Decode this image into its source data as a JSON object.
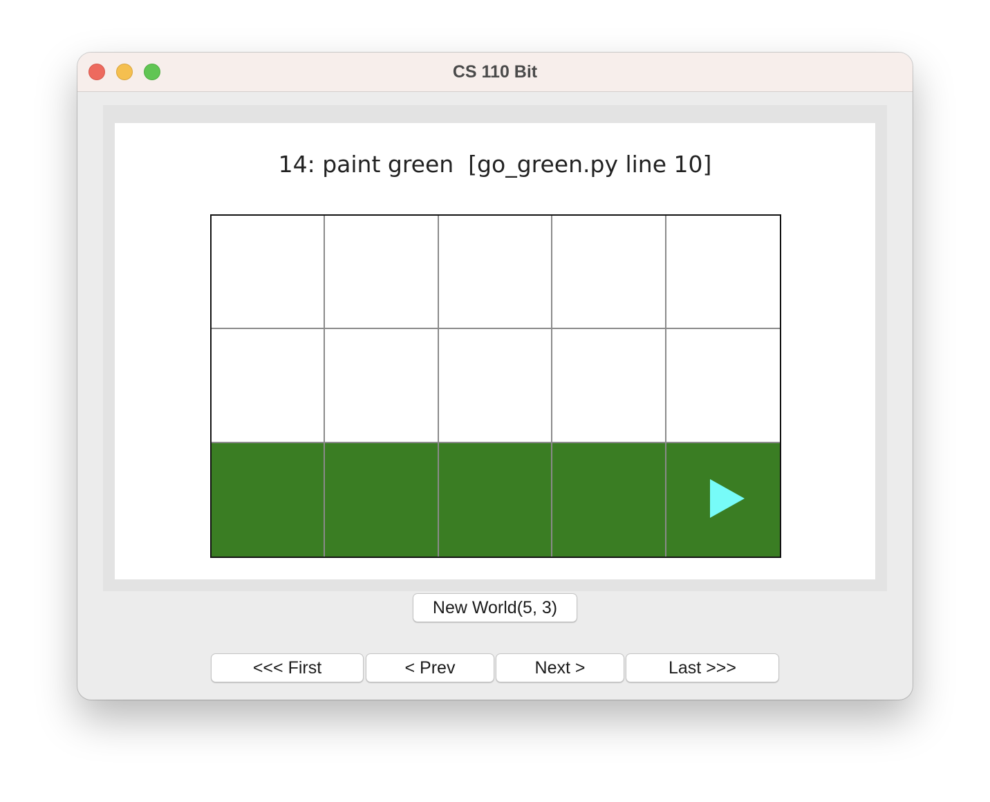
{
  "window": {
    "title": "CS 110 Bit"
  },
  "canvas": {
    "status_text": "14: paint green  [go_green.py line 10]"
  },
  "world": {
    "cols": 5,
    "rows": 3,
    "cells": [
      [
        "white",
        "white",
        "white",
        "white",
        "white"
      ],
      [
        "white",
        "white",
        "white",
        "white",
        "white"
      ],
      [
        "green",
        "green",
        "green",
        "green",
        "green"
      ]
    ],
    "colors": {
      "white": "#ffffff",
      "green": "#3a7d23"
    },
    "bit": {
      "row": 2,
      "col": 4,
      "direction": "right",
      "color": "#77fbf8",
      "icon": "bit-arrow-right-icon"
    }
  },
  "buttons": {
    "new_world": "New World(5, 3)",
    "first": "<<< First",
    "prev": "< Prev",
    "next": "Next >",
    "last": "Last >>>"
  }
}
